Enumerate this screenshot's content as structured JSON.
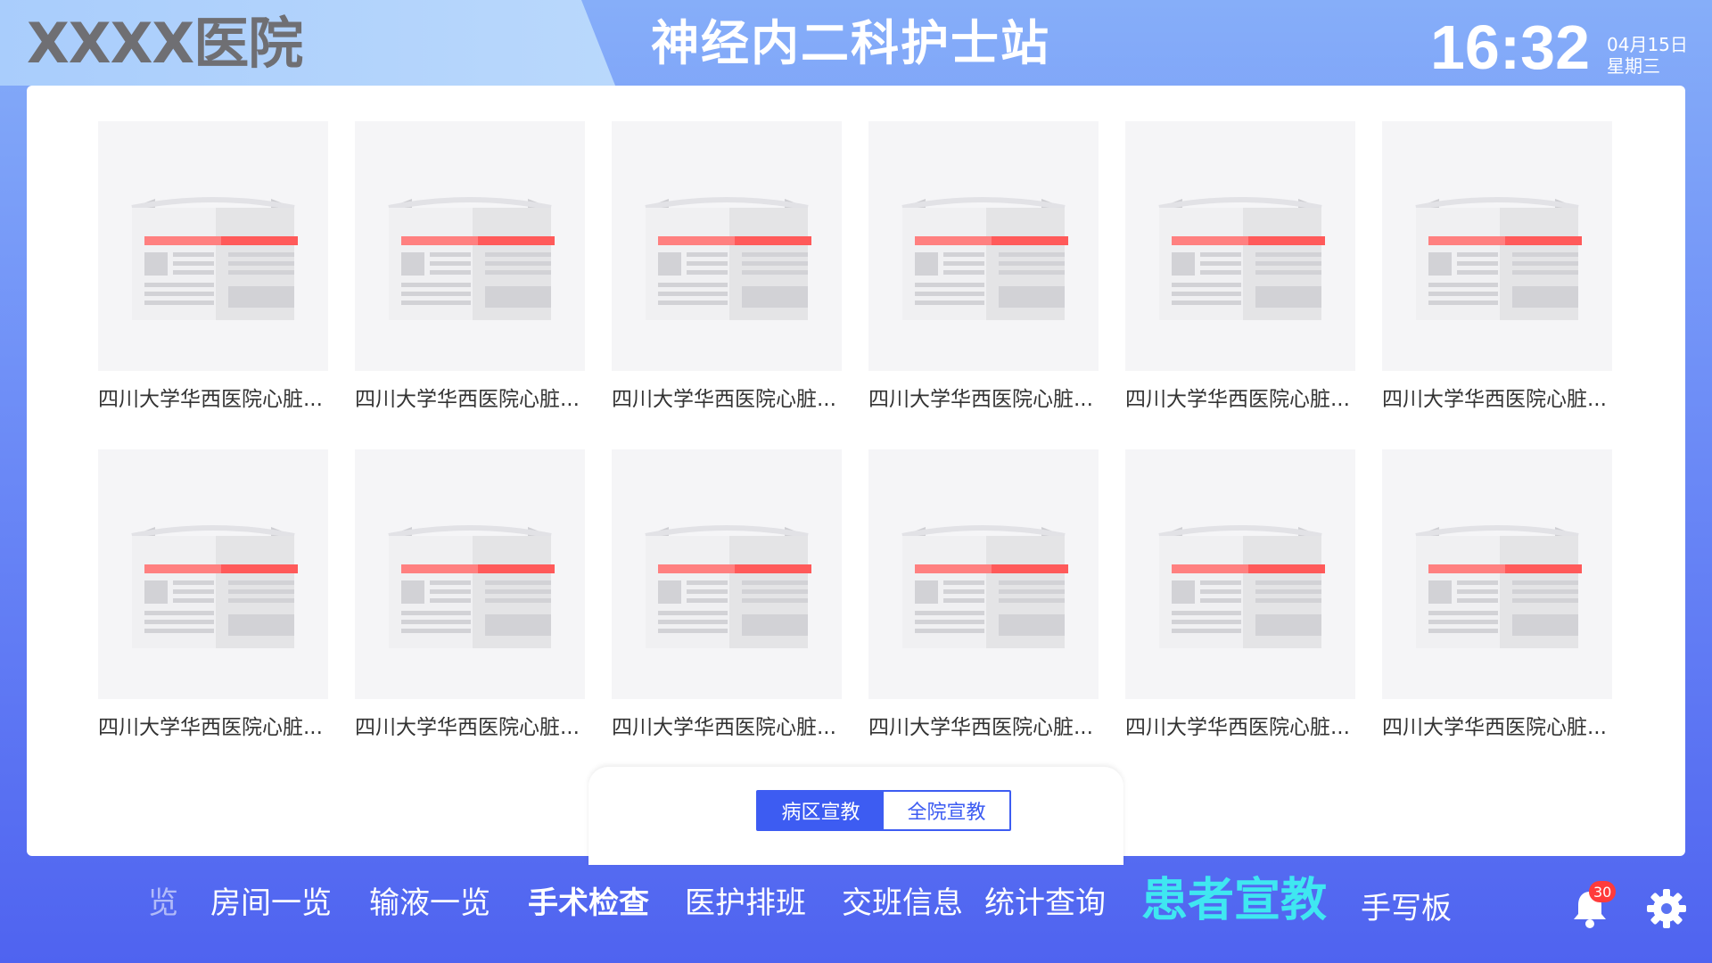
{
  "header": {
    "hospital_name": "XXXX医院",
    "station_title": "神经内二科护士站",
    "time": "16:32",
    "date": "04月15日",
    "weekday": "星期三"
  },
  "cards": [
    {
      "title": "四川大学华西医院心脏..."
    },
    {
      "title": "四川大学华西医院心脏..."
    },
    {
      "title": "四川大学华西医院心脏..."
    },
    {
      "title": "四川大学华西医院心脏..."
    },
    {
      "title": "四川大学华西医院心脏..."
    },
    {
      "title": "四川大学华西医院心脏..."
    },
    {
      "title": "四川大学华西医院心脏..."
    },
    {
      "title": "四川大学华西医院心脏..."
    },
    {
      "title": "四川大学华西医院心脏..."
    },
    {
      "title": "四川大学华西医院心脏..."
    },
    {
      "title": "四川大学华西医院心脏..."
    },
    {
      "title": "四川大学华西医院心脏..."
    }
  ],
  "tabs": [
    {
      "label": "病区宣教",
      "active": true
    },
    {
      "label": "全院宣教",
      "active": false
    }
  ],
  "nav": {
    "items": [
      {
        "label": "览"
      },
      {
        "label": "房间一览"
      },
      {
        "label": "输液一览"
      },
      {
        "label": "手术检查"
      },
      {
        "label": "医护排班"
      },
      {
        "label": "交班信息"
      },
      {
        "label": "统计查询"
      },
      {
        "label": "患者宣教"
      },
      {
        "label": "手写板"
      }
    ],
    "active": "患者宣教",
    "notification_count": "30"
  },
  "icons": {
    "thumbnail": "newspaper-icon",
    "bell": "bell-icon",
    "settings": "gear-icon"
  },
  "colors": {
    "accent": "#3d5cf2",
    "active_nav": "#3fe7f1",
    "badge": "#ff3b3b",
    "thumbnail_stripe": "#ff5a5a"
  }
}
